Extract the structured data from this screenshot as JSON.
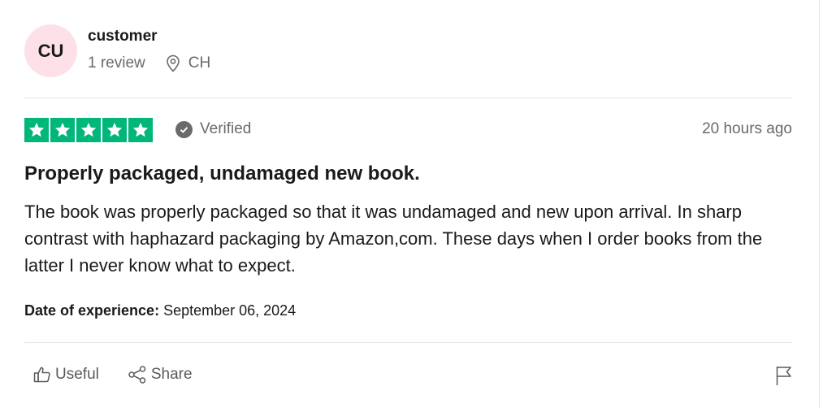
{
  "reviewer": {
    "initials": "CU",
    "name": "customer",
    "review_count": "1 review",
    "location": "CH",
    "avatar_color": "#fde0e8"
  },
  "rating": {
    "stars": 5,
    "max_stars": 5,
    "star_color": "#00b67a",
    "verified_label": "Verified",
    "posted": "20 hours ago"
  },
  "review": {
    "title": "Properly packaged, undamaged new book.",
    "body": "The book was properly packaged so that it was undamaged and new upon arrival. In sharp contrast with haphazard packaging by Amazon,com. These days when I order books from the latter I never know what to expect.",
    "experience_label": "Date of experience:",
    "experience_date": "September 06, 2024"
  },
  "actions": {
    "useful_label": "Useful",
    "share_label": "Share",
    "icons": [
      "thumbs-up-icon",
      "share-icon",
      "flag-icon"
    ]
  }
}
